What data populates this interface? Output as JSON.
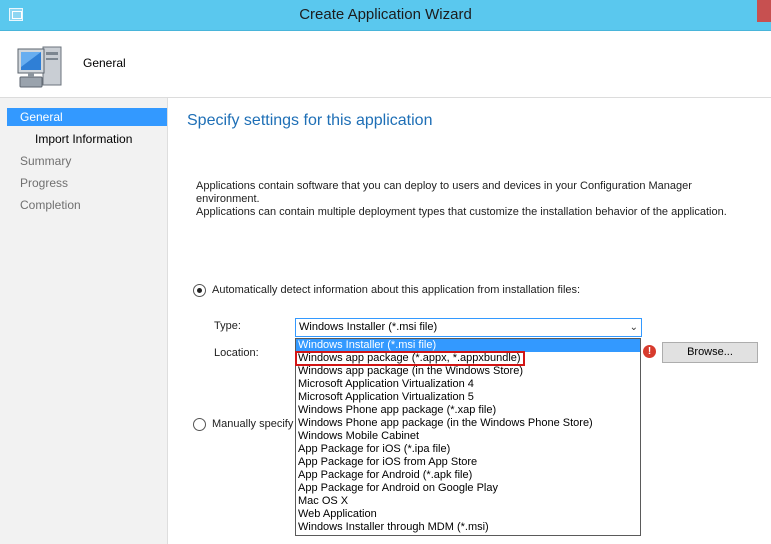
{
  "window": {
    "title": "Create Application Wizard"
  },
  "header": {
    "title": "General"
  },
  "sidebar": {
    "items": [
      {
        "label": "General",
        "state": "active"
      },
      {
        "label": "Import Information",
        "state": "done",
        "sub": true
      },
      {
        "label": "Summary",
        "state": "pending"
      },
      {
        "label": "Progress",
        "state": "pending"
      },
      {
        "label": "Completion",
        "state": "pending"
      }
    ]
  },
  "main": {
    "heading": "Specify settings for this application",
    "intro_line1": "Applications contain software that you can deploy to users and devices in your Configuration Manager environment.",
    "intro_line2": "Applications can contain multiple deployment types that customize the installation behavior of the application.",
    "auto_detect_label": "Automatically detect information about this application from installation files:",
    "manual_label": "Manually specify t",
    "type_label": "Type:",
    "location_label": "Location:",
    "type_value": "Windows Installer (*.msi file)",
    "browse_label": "Browse...",
    "error_glyph": "!"
  },
  "dropdown_options": [
    "Windows Installer (*.msi file)",
    "Windows app package (*.appx, *.appxbundle)",
    "Windows app package (in the Windows Store)",
    "Microsoft Application Virtualization 4",
    "Microsoft Application Virtualization 5",
    "Windows Phone app package (*.xap file)",
    "Windows Phone app package (in the Windows Phone Store)",
    "Windows Mobile Cabinet",
    "App Package for iOS (*.ipa file)",
    "App Package for iOS from App Store",
    "App Package for Android (*.apk file)",
    "App Package for Android on Google Play",
    "Mac OS X",
    "Web Application",
    "Windows Installer through MDM (*.msi)"
  ],
  "colors": {
    "titlebar": "#5ac8ee",
    "accent": "#3399ff",
    "heading": "#1e6fb6",
    "highlight_box": "#d21515",
    "error": "#d73b2d"
  }
}
